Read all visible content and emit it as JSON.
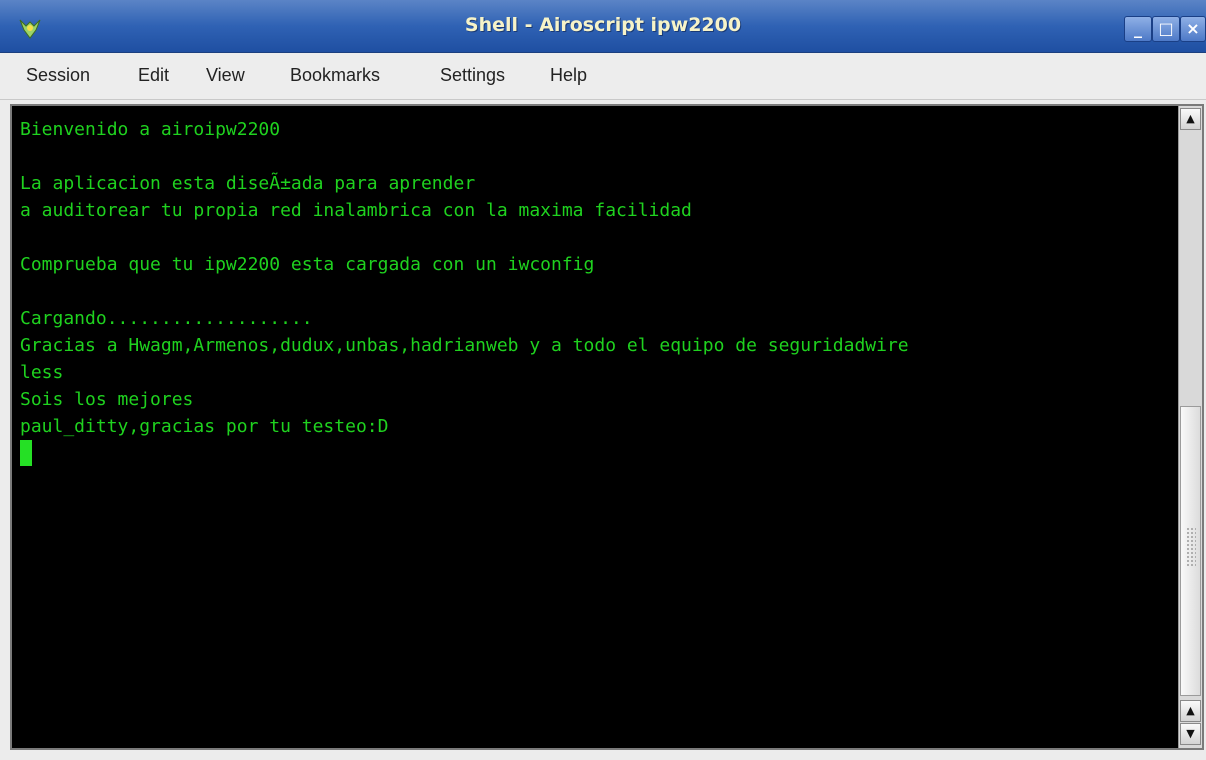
{
  "window": {
    "title": "Shell - Airoscript ipw2200",
    "buttons": {
      "minimize": "_",
      "maximize": "□",
      "close": "×"
    },
    "icon": "konsole-app-icon"
  },
  "menubar": {
    "items": [
      "Session",
      "Edit",
      "View",
      "Bookmarks",
      "Settings",
      "Help"
    ]
  },
  "terminal": {
    "text_color": "#1fd21f",
    "background": "#000000",
    "lines": [
      "Bienvenido a airoipw2200",
      "",
      "La aplicacion esta diseÃ±ada para aprender",
      "a auditorear tu propia red inalambrica con la maxima facilidad",
      "",
      "Comprueba que tu ipw2200 esta cargada con un iwconfig",
      "",
      "Cargando...................",
      "Gracias a Hwagm,Armenos,dudux,unbas,hadrianweb y a todo el equipo de seguridadwire",
      "less",
      "Sois los mejores",
      "paul_ditty,gracias por tu testeo:D"
    ]
  },
  "scrollbar": {
    "up_arrow": "▲",
    "down_arrow": "▼"
  }
}
